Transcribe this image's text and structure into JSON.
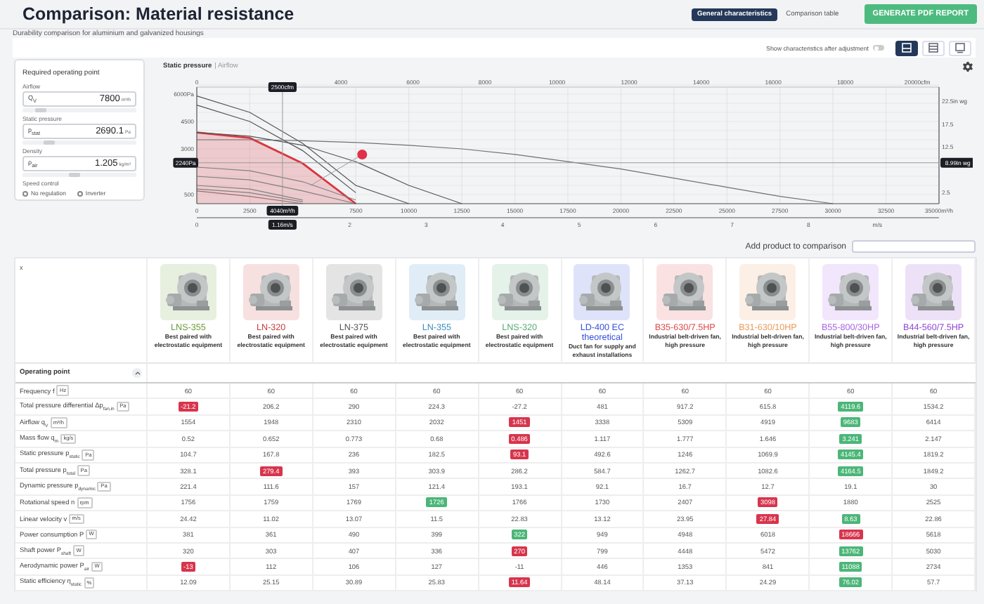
{
  "header": {
    "title": "Comparison: Material resistance",
    "tabs": [
      {
        "label": "General characteristics",
        "selected": true
      },
      {
        "label": "Comparison table",
        "selected": false
      }
    ],
    "report_button": "GENERATE PDF REPORT"
  },
  "subtitle": "Durability comparison for aluminium and galvanized housings",
  "toolbar": {
    "toggle": {
      "label": "Show characteristics after adjustment",
      "on": false
    },
    "views": [
      {
        "kind": "list",
        "selected": true
      },
      {
        "kind": "split",
        "selected": false
      },
      {
        "kind": "single",
        "selected": false
      }
    ]
  },
  "operating_point": {
    "title": "Required operating point",
    "fields": [
      {
        "label": "Airflow",
        "symbol": "Q$_{V}$",
        "value": "7800",
        "unit": "m³/h",
        "level": 0.12
      },
      {
        "label": "Static pressure",
        "symbol": "p$_{stat}$",
        "value": "2690.1",
        "unit": "Pa",
        "level": 0.2
      },
      {
        "label": "Density",
        "symbol": "ρ$_{air}$",
        "value": "1.205",
        "unit": "kg/m³",
        "level": 0.45
      }
    ],
    "speed_control": {
      "label": "Speed control",
      "options": [
        {
          "label": "No regulation",
          "selected": false
        },
        {
          "label": "Inverter",
          "selected": false
        }
      ]
    }
  },
  "chart": {
    "title": "Static pressure",
    "subtitle": "| Airflow",
    "top_axis": [
      "0",
      "4000",
      "6000",
      "8000",
      "10000",
      "12000",
      "14000",
      "16000",
      "18000",
      "20000cfm"
    ],
    "velocity_axis": {
      "ticks": [
        "0",
        "2",
        "3",
        "4",
        "5",
        "6",
        "7",
        "8"
      ],
      "unit": "m/s"
    },
    "right_axis": [
      "22.5in wg",
      "17.5",
      "12.5",
      "2.5"
    ],
    "cursor": {
      "cfm": "2500cfm",
      "velocity": "1.16m/s",
      "wg": "8.99in wg"
    },
    "chart_data": {
      "type": "line",
      "grid": true,
      "xlim": [
        0,
        35000
      ],
      "ylim": [
        0,
        6000
      ],
      "ref_lines": [
        {
          "axis": "x",
          "value": 4040,
          "label": "4040m³/h"
        },
        {
          "axis": "y",
          "value": 2240,
          "label": "2240Pa"
        }
      ],
      "x": [
        0,
        2500,
        5000,
        7500,
        10000,
        12500,
        15000,
        17500,
        20000,
        22500,
        25000,
        27500,
        30000
      ],
      "xticks": [
        0,
        2500,
        7500,
        10000,
        12500,
        15000,
        17500,
        20000,
        22500,
        25000,
        27500,
        30000,
        32500,
        {
          "value": 35000,
          "label": "35000m³/h"
        }
      ],
      "yticks": [
        500,
        3000,
        4500,
        {
          "value": 6000,
          "label": "6000Pa"
        }
      ],
      "series": [
        {
          "color": "#808080",
          "values": [
            700,
            400,
            0,
            null,
            null,
            null,
            null,
            null,
            null,
            null,
            null,
            null,
            null
          ]
        },
        {
          "color": "#d9363e",
          "values": [
            3900,
            3600,
            2200,
            0,
            null,
            null,
            null,
            null,
            null,
            null,
            null,
            null,
            null
          ]
        },
        {
          "color": "#808080",
          "values": [
            1500,
            1300,
            700,
            0,
            null,
            null,
            null,
            null,
            null,
            null,
            null,
            null,
            null
          ]
        },
        {
          "color": "#808080",
          "values": [
            1000,
            800,
            200,
            null,
            null,
            null,
            null,
            null,
            null,
            null,
            null,
            null,
            null
          ]
        },
        {
          "color": "#808080",
          "values": [
            800,
            600,
            100,
            null,
            null,
            null,
            null,
            null,
            null,
            null,
            null,
            null,
            null
          ]
        },
        {
          "color": "#808080",
          "values": [
            2000,
            1800,
            1200,
            200,
            null,
            null,
            null,
            null,
            null,
            null,
            null,
            null,
            null
          ]
        },
        {
          "color": "#555555",
          "values": [
            5900,
            5000,
            3300,
            1000,
            0,
            null,
            null,
            null,
            null,
            null,
            null,
            null,
            null
          ]
        },
        {
          "color": "#555555",
          "values": [
            5400,
            4500,
            2900,
            600,
            null,
            null,
            null,
            null,
            null,
            null,
            null,
            null,
            null
          ]
        },
        {
          "color": "#707070",
          "values": [
            3500,
            3500,
            3450,
            3350,
            3200,
            3000,
            2700,
            2300,
            1900,
            1400,
            900,
            400,
            0
          ]
        },
        {
          "color": "#555555",
          "values": [
            3900,
            3700,
            3200,
            2300,
            1000,
            0,
            null,
            null,
            null,
            null,
            null,
            null,
            null
          ]
        }
      ]
    }
  },
  "add_product": {
    "label": "Add product to comparison"
  },
  "table": {
    "corner": "x",
    "products": [
      {
        "name": "LNS-355",
        "color": "#6b9b37",
        "description": "Best paired with electrostatic equipment"
      },
      {
        "name": "LN-320",
        "color": "#cc3b3b",
        "description": "Best paired with electrostatic equipment"
      },
      {
        "name": "LN-375",
        "color": "#555555",
        "description": "Best paired with electrostatic equipment"
      },
      {
        "name": "LN-355",
        "color": "#3d8fc4",
        "description": "Best paired with electrostatic equipment"
      },
      {
        "name": "LNS-320",
        "color": "#56ad73",
        "description": "Best paired with electrostatic equipment"
      },
      {
        "name": "LD-400 EC theoretical",
        "color": "#3350e0",
        "description": "Duct fan for supply and exhaust installations"
      },
      {
        "name": "B35-630/7.5HP",
        "color": "#de4a4a",
        "description": "Industrial belt-driven fan, high pressure"
      },
      {
        "name": "B31-630/10HP",
        "color": "#eb9a5a",
        "description": "Industrial belt-driven fan, high pressure"
      },
      {
        "name": "B55-800/30HP",
        "color": "#a765e6",
        "description": "Industrial belt-driven fan, high pressure"
      },
      {
        "name": "B44-560/7.5HP",
        "color": "#8f45d6",
        "description": "Industrial belt-driven fan, high pressure"
      }
    ],
    "section": {
      "title": "Operating point",
      "expanded": true
    },
    "rows": [
      {
        "label": "Frequency f",
        "unit": "Hz",
        "cells": [
          "60",
          "60",
          "60",
          "60",
          "60",
          "60",
          "60",
          "60",
          "60",
          "60"
        ]
      },
      {
        "label": "Total pressure differential Δp$_{fan,in}$",
        "unit": "Pa",
        "cells": [
          {
            "text": "-21.2",
            "color": "#d7354d"
          },
          "206.2",
          "290",
          "224.3",
          "-27.2",
          "481",
          "917.2",
          "615.8",
          {
            "text": "4119.6",
            "color": "#4bb678"
          },
          "1534.2"
        ]
      },
      {
        "label": "Airflow q$_{V}$",
        "unit": "m³/h",
        "cells": [
          "1554",
          "1948",
          "2310",
          "2032",
          {
            "text": "1451",
            "color": "#d7354d"
          },
          "3338",
          "5309",
          "4919",
          {
            "text": "9683",
            "color": "#4bb678"
          },
          "6414"
        ]
      },
      {
        "label": "Mass flow q$_{m}$",
        "unit": "kg/s",
        "cells": [
          "0.52",
          "0.652",
          "0.773",
          "0.68",
          {
            "text": "0.486",
            "color": "#d7354d"
          },
          "1.117",
          "1.777",
          "1.646",
          {
            "text": "3.241",
            "color": "#4bb678"
          },
          "2.147"
        ]
      },
      {
        "label": "Static pressure p$_{static}$",
        "unit": "Pa",
        "cells": [
          "104.7",
          "167.8",
          "236",
          "182.5",
          {
            "text": "93.1",
            "color": "#d7354d"
          },
          "492.6",
          "1246",
          "1069.9",
          {
            "text": "4145.4",
            "color": "#4bb678"
          },
          "1819.2"
        ]
      },
      {
        "label": "Total pressure p$_{total}$",
        "unit": "Pa",
        "cells": [
          "328.1",
          {
            "text": "279.4",
            "color": "#d7354d"
          },
          "393",
          "303.9",
          "286.2",
          "584.7",
          "1262.7",
          "1082.6",
          {
            "text": "4164.5",
            "color": "#4bb678"
          },
          "1849.2"
        ]
      },
      {
        "label": "Dynamic pressure p$_{dynamic}$",
        "unit": "Pa",
        "cells": [
          "221.4",
          "111.6",
          "157",
          "121.4",
          "193.1",
          "92.1",
          "16.7",
          "12.7",
          "19.1",
          "30"
        ]
      },
      {
        "label": "Rotational speed n",
        "unit": "rpm",
        "cells": [
          "1756",
          "1759",
          "1769",
          {
            "text": "1726",
            "color": "#4bb678"
          },
          "1766",
          "1730",
          "2407",
          {
            "text": "3098",
            "color": "#d7354d"
          },
          "1880",
          "2525"
        ]
      },
      {
        "label": "Linear velocity v",
        "unit": "m/s",
        "cells": [
          "24.42",
          "11.02",
          "13.07",
          "11.5",
          "22.83",
          "13.12",
          "23.95",
          {
            "text": "27.84",
            "color": "#d7354d"
          },
          {
            "text": "8.63",
            "color": "#4bb678"
          },
          "22.86"
        ]
      },
      {
        "label": "Power consumption P",
        "unit": "W",
        "cells": [
          "381",
          "361",
          "490",
          "399",
          {
            "text": "322",
            "color": "#4bb678"
          },
          "949",
          "4948",
          "6018",
          {
            "text": "18666",
            "color": "#d7354d"
          },
          "5618"
        ]
      },
      {
        "label": "Shaft power P$_{shaft}$",
        "unit": "W",
        "cells": [
          "320",
          "303",
          "407",
          "336",
          {
            "text": "270",
            "color": "#d7354d"
          },
          "799",
          "4448",
          "5472",
          {
            "text": "13762",
            "color": "#4bb678"
          },
          "5030"
        ]
      },
      {
        "label": "Aerodynamic power P$_{air}$",
        "unit": "W",
        "cells": [
          {
            "text": "-13",
            "color": "#d7354d"
          },
          "112",
          "106",
          "127",
          "-11",
          "446",
          "1353",
          "841",
          {
            "text": "11088",
            "color": "#4bb678"
          },
          "2734"
        ]
      },
      {
        "label": "Static efficiency η$_{static}$",
        "unit": "%",
        "cells": [
          "12.09",
          "25.15",
          "30.89",
          "25.83",
          {
            "text": "11.64",
            "color": "#d7354d"
          },
          "48.14",
          "37.13",
          "24.29",
          {
            "text": "76.02",
            "color": "#4bb678"
          },
          "57.7"
        ]
      }
    ]
  }
}
